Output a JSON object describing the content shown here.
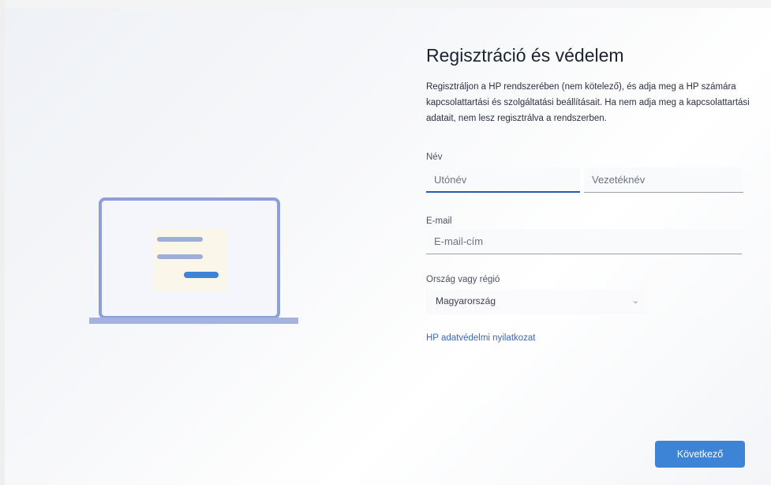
{
  "page": {
    "title": "Regisztráció és védelem",
    "description": "Regisztráljon a HP rendszerében (nem kötelező), és adja meg a HP számára kapcsolattartási és szolgáltatási beállításait. Ha nem adja meg a kapcsolattartási adatait, nem lesz regisztrálva a rendszerben."
  },
  "form": {
    "name_label": "Név",
    "first_name_placeholder": "Utónév",
    "last_name_placeholder": "Vezetéknév",
    "email_label": "E-mail",
    "email_placeholder": "E-mail-cím",
    "country_label": "Ország vagy régió",
    "country_value": "Magyarország"
  },
  "privacy_link": "HP adatvédelmi nyilatkozat",
  "next_button": "Következő",
  "colors": {
    "accent": "#3d83d6",
    "link": "#3b68b4",
    "illustration_frame": "#8d9fd6"
  },
  "icons": {
    "dropdown": "chevron-down-icon",
    "illustration": "laptop-illustration"
  }
}
